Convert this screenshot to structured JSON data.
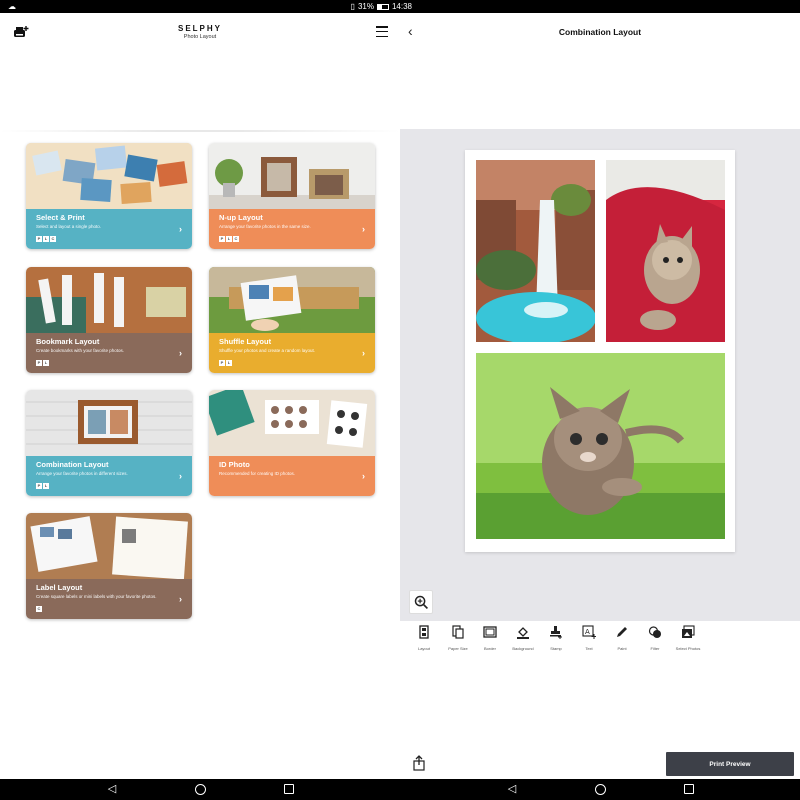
{
  "status_bar": {
    "battery": "31%",
    "time": "14:38"
  },
  "app": {
    "brand": "SELPHY",
    "subtitle": "Photo Layout"
  },
  "cards": [
    {
      "title": "Select & Print",
      "desc": "Select and layout a single photo.",
      "sizes": [
        "P",
        "L",
        "C"
      ],
      "color": "#56b2c4"
    },
    {
      "title": "N-up Layout",
      "desc": "Arrange your favorite photos in the same size.",
      "sizes": [
        "P",
        "L",
        "C"
      ],
      "color": "#ef8d58"
    },
    {
      "title": "Bookmark Layout",
      "desc": "Create bookmarks with your favorite photos.",
      "sizes": [
        "P",
        "L"
      ],
      "color": "#8a6a5a"
    },
    {
      "title": "Shuffle Layout",
      "desc": "Shuffle your photos and create a random layout.",
      "sizes": [
        "P",
        "L"
      ],
      "color": "#e9ad2e"
    },
    {
      "title": "Combination Layout",
      "desc": "Arrange your favorite photos in different sizes.",
      "sizes": [
        "P",
        "L"
      ],
      "color": "#56b2c4"
    },
    {
      "title": "ID Photo",
      "desc": "Recommended for creating ID photos.",
      "sizes": [],
      "color": "#ef8d58"
    },
    {
      "title": "Label Layout",
      "desc": "Create square labels or mini labels with your favorite photos.",
      "sizes": [
        "C"
      ],
      "color": "#8a6a5a"
    }
  ],
  "editor": {
    "title": "Combination Layout",
    "tools": [
      "Layout",
      "Paper Size",
      "Border",
      "Background",
      "Stamp",
      "Text",
      "Paint",
      "Filter",
      "Select Photos"
    ],
    "print_preview": "Print Preview"
  }
}
